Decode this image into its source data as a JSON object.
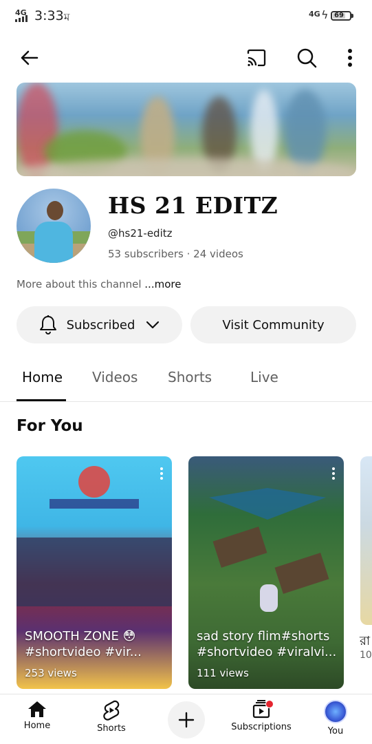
{
  "status_bar": {
    "network": "4G",
    "time": "3:33",
    "sim_icon": "ম",
    "network_right": "4G",
    "battery": "69"
  },
  "top_bar": {
    "back_icon": "arrow-left-icon",
    "cast_icon": "cast-icon",
    "search_icon": "search-icon",
    "more_icon": "more-vert-icon"
  },
  "channel": {
    "name": "HS 21 EDITZ",
    "handle": "@hs21-editz",
    "subscribers": "53 subscribers",
    "separator": "·",
    "videos": "24 videos",
    "about": "More about this channel",
    "more_link": "...more"
  },
  "actions": {
    "subscribed_label": "Subscribed",
    "community_label": "Visit Community"
  },
  "tabs": [
    {
      "label": "Home",
      "active": true
    },
    {
      "label": "Videos",
      "active": false
    },
    {
      "label": "Shorts",
      "active": false
    },
    {
      "label": "Live",
      "active": false
    }
  ],
  "section": {
    "title": "For You"
  },
  "shorts": [
    {
      "title": "SMOOTH ZONE 😳#shortvideo #vir...",
      "views": "253 views"
    },
    {
      "title": "sad story flim#shorts #shortvideo #viralvi...",
      "views": "111 views"
    }
  ],
  "partial_card": {
    "title": "রা",
    "sub": "10"
  },
  "bottom_nav": [
    {
      "label": "Home",
      "icon": "home-icon"
    },
    {
      "label": "Shorts",
      "icon": "shorts-icon"
    },
    {
      "label": "",
      "icon": "plus-icon"
    },
    {
      "label": "Subscriptions",
      "icon": "subscriptions-icon"
    },
    {
      "label": "You",
      "icon": "avatar-icon"
    }
  ]
}
